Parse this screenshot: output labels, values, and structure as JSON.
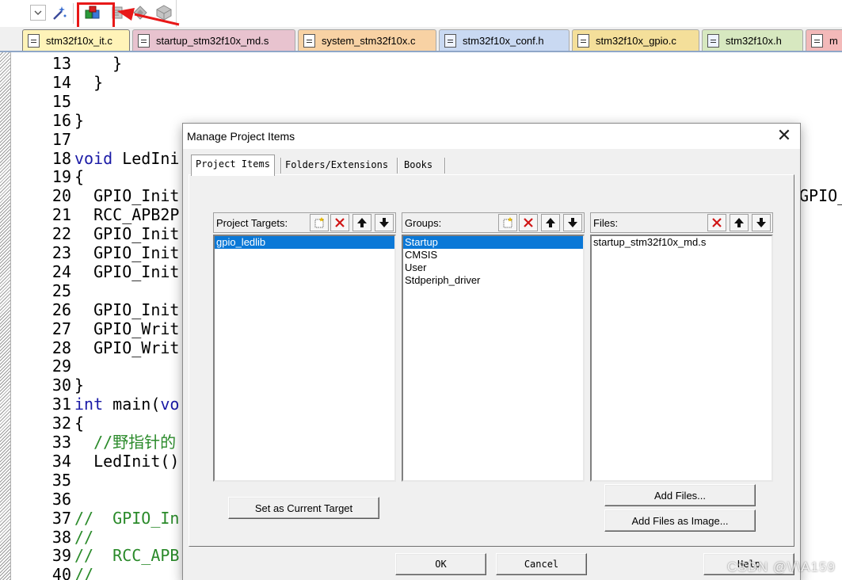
{
  "editor_tabs": [
    {
      "label": "stm32f10x_it.c",
      "color": "#f7e39b",
      "kind": "c"
    },
    {
      "label": "startup_stm32f10x_md.s",
      "color": "#e8c3cf",
      "kind": "s"
    },
    {
      "label": "system_stm32f10x.c",
      "color": "#f8d2a4",
      "kind": "c"
    },
    {
      "label": "stm32f10x_conf.h",
      "color": "#c9d9f2",
      "kind": "h"
    },
    {
      "label": "stm32f10x_gpio.c",
      "color": "#f4df9a",
      "kind": "c"
    },
    {
      "label": "stm32f10x.h",
      "color": "#d7e8c0",
      "kind": "h"
    },
    {
      "label": "m",
      "color": "#f3b9b9",
      "kind": "c"
    }
  ],
  "code_lines": [
    {
      "num": "13",
      "text": "    }"
    },
    {
      "num": "14",
      "text": "  }"
    },
    {
      "num": "15",
      "text": ""
    },
    {
      "num": "16",
      "text": "}"
    },
    {
      "num": "17",
      "text": ""
    },
    {
      "num": "18",
      "kw": "void",
      "text": " LedIni"
    },
    {
      "num": "19",
      "text": "{"
    },
    {
      "num": "20",
      "text": "  GPIO_Init",
      "tail": "GPIO_I"
    },
    {
      "num": "21",
      "text": "  RCC_APB2P"
    },
    {
      "num": "22",
      "text": "  GPIO_Init"
    },
    {
      "num": "23",
      "text": "  GPIO_Init"
    },
    {
      "num": "24",
      "text": "  GPIO_Init"
    },
    {
      "num": "25",
      "text": ""
    },
    {
      "num": "26",
      "text": "  GPIO_Init"
    },
    {
      "num": "27",
      "text": "  GPIO_Writ"
    },
    {
      "num": "28",
      "text": "  GPIO_Writ"
    },
    {
      "num": "29",
      "text": ""
    },
    {
      "num": "30",
      "text": "}"
    },
    {
      "num": "31",
      "kw": "int",
      "text": " main(",
      "kw2": "vo"
    },
    {
      "num": "32",
      "text": "{"
    },
    {
      "num": "33",
      "comment": "  //野指针的"
    },
    {
      "num": "34",
      "text": "  LedInit()"
    },
    {
      "num": "35",
      "text": ""
    },
    {
      "num": "36",
      "text": ""
    },
    {
      "num": "37",
      "comment": "//  GPIO_In"
    },
    {
      "num": "38",
      "comment": "//"
    },
    {
      "num": "39",
      "comment": "//  RCC_APB"
    },
    {
      "num": "40",
      "comment": "//"
    }
  ],
  "toolbar": {
    "icons": [
      "dropdown-icon",
      "magic-wand-icon",
      "manage-project-items-icon",
      "options-icon",
      "pack-installer-icon",
      "software-components-icon"
    ]
  },
  "dialog": {
    "title": "Manage Project Items",
    "close_glyph": "✕",
    "tabs": [
      "Project Items",
      "Folders/Extensions",
      "Books"
    ],
    "targets": {
      "label": "Project Targets:",
      "items": [
        "gpio_ledlib"
      ],
      "selected": 0
    },
    "groups": {
      "label": "Groups:",
      "items": [
        "Startup",
        "CMSIS",
        "User",
        "Stdperiph_driver"
      ],
      "selected": 0
    },
    "files": {
      "label": "Files:",
      "items": [
        "startup_stm32f10x_md.s"
      ],
      "selected": -1
    },
    "set_target_button": "Set as Current Target",
    "add_files_button": "Add Files...",
    "add_files_image_button": "Add Files as Image...",
    "ok_button": "OK",
    "cancel_button": "Cancel",
    "help_button": "Help"
  },
  "watermark": "CSDN @\\/\\A159",
  "colors": {
    "highlight": "#e81818",
    "selection": "#0a78d7",
    "keyword": "#1a1aa6",
    "comment": "#2a8a2a"
  }
}
